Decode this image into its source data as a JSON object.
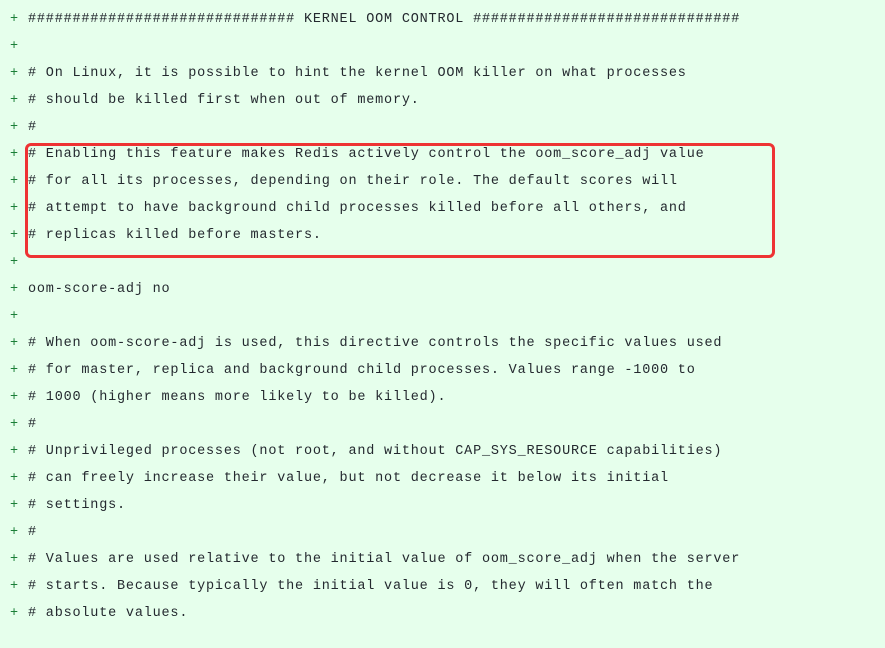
{
  "diff": {
    "marker": "+",
    "lines": [
      "############################## KERNEL OOM CONTROL ##############################",
      "",
      "# On Linux, it is possible to hint the kernel OOM killer on what processes",
      "# should be killed first when out of memory.",
      "#",
      "# Enabling this feature makes Redis actively control the oom_score_adj value",
      "# for all its processes, depending on their role. The default scores will",
      "# attempt to have background child processes killed before all others, and",
      "# replicas killed before masters.",
      "",
      "oom-score-adj no",
      "",
      "# When oom-score-adj is used, this directive controls the specific values used",
      "# for master, replica and background child processes. Values range -1000 to",
      "# 1000 (higher means more likely to be killed).",
      "#",
      "# Unprivileged processes (not root, and without CAP_SYS_RESOURCE capabilities)",
      "# can freely increase their value, but not decrease it below its initial",
      "# settings.",
      "#",
      "# Values are used relative to the initial value of oom_score_adj when the server",
      "# starts. Because typically the initial value is 0, they will often match the",
      "# absolute values."
    ]
  },
  "highlight": {
    "start_line_index": 5,
    "end_line_index": 8
  }
}
